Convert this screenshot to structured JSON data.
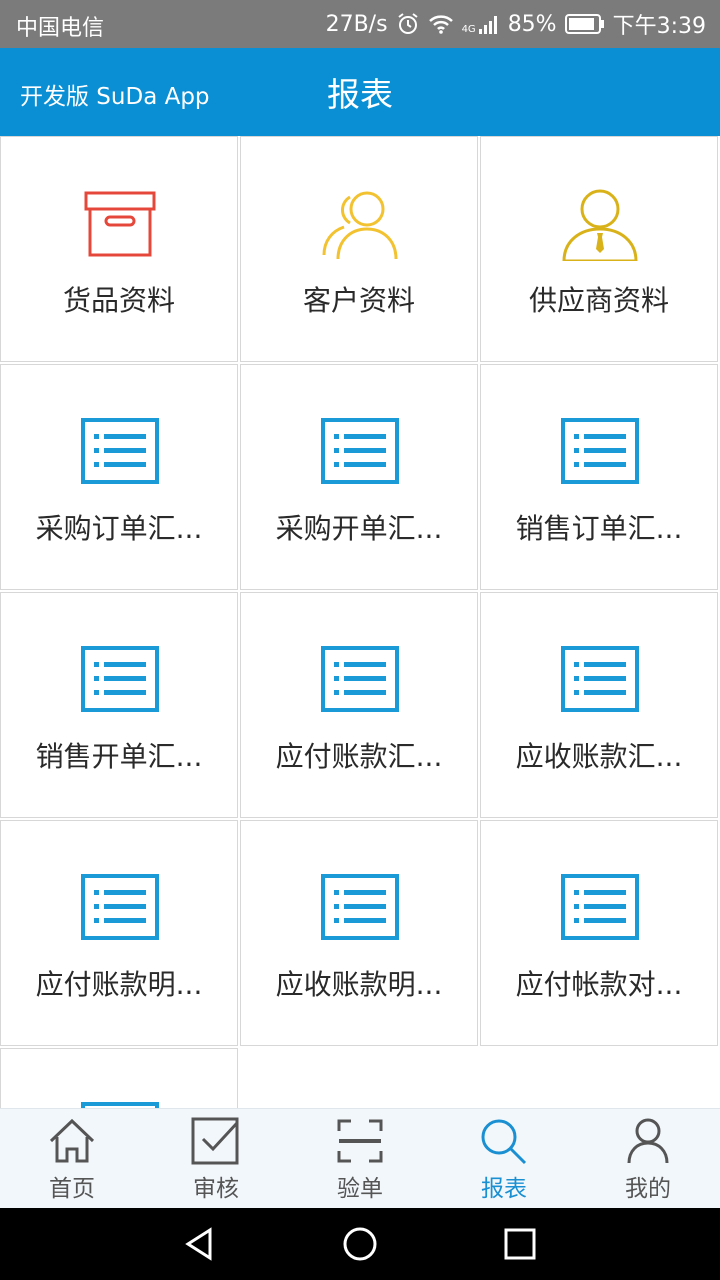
{
  "status_bar": {
    "carrier": "中国电信",
    "speed": "27B/s",
    "network": "4G",
    "battery": "85%",
    "time": "下午3:39"
  },
  "app_bar": {
    "brand": "开发版 SuDa App",
    "title": "报表"
  },
  "colors": {
    "accent": "#0b8fd4",
    "list_icon": "#1a9ad6",
    "box_icon": "#e5483b",
    "customer_icon": "#f2c230",
    "supplier_icon": "#d9b21a"
  },
  "grid": {
    "items": [
      {
        "label": "货品资料",
        "icon": "box-icon"
      },
      {
        "label": "客户资料",
        "icon": "users-icon"
      },
      {
        "label": "供应商资料",
        "icon": "supplier-icon"
      },
      {
        "label": "采购订单汇...",
        "icon": "list-icon"
      },
      {
        "label": "采购开单汇...",
        "icon": "list-icon"
      },
      {
        "label": "销售订单汇...",
        "icon": "list-icon"
      },
      {
        "label": "销售开单汇...",
        "icon": "list-icon"
      },
      {
        "label": "应付账款汇...",
        "icon": "list-icon"
      },
      {
        "label": "应收账款汇...",
        "icon": "list-icon"
      },
      {
        "label": "应付账款明...",
        "icon": "list-icon"
      },
      {
        "label": "应收账款明...",
        "icon": "list-icon"
      },
      {
        "label": "应付帐款对...",
        "icon": "list-icon"
      },
      {
        "label": "",
        "icon": "list-icon"
      }
    ]
  },
  "bottom_nav": {
    "items": [
      {
        "label": "首页",
        "icon": "home-icon"
      },
      {
        "label": "审核",
        "icon": "check-box-icon"
      },
      {
        "label": "验单",
        "icon": "scan-icon"
      },
      {
        "label": "报表",
        "icon": "search-icon",
        "active": true
      },
      {
        "label": "我的",
        "icon": "user-icon"
      }
    ]
  }
}
